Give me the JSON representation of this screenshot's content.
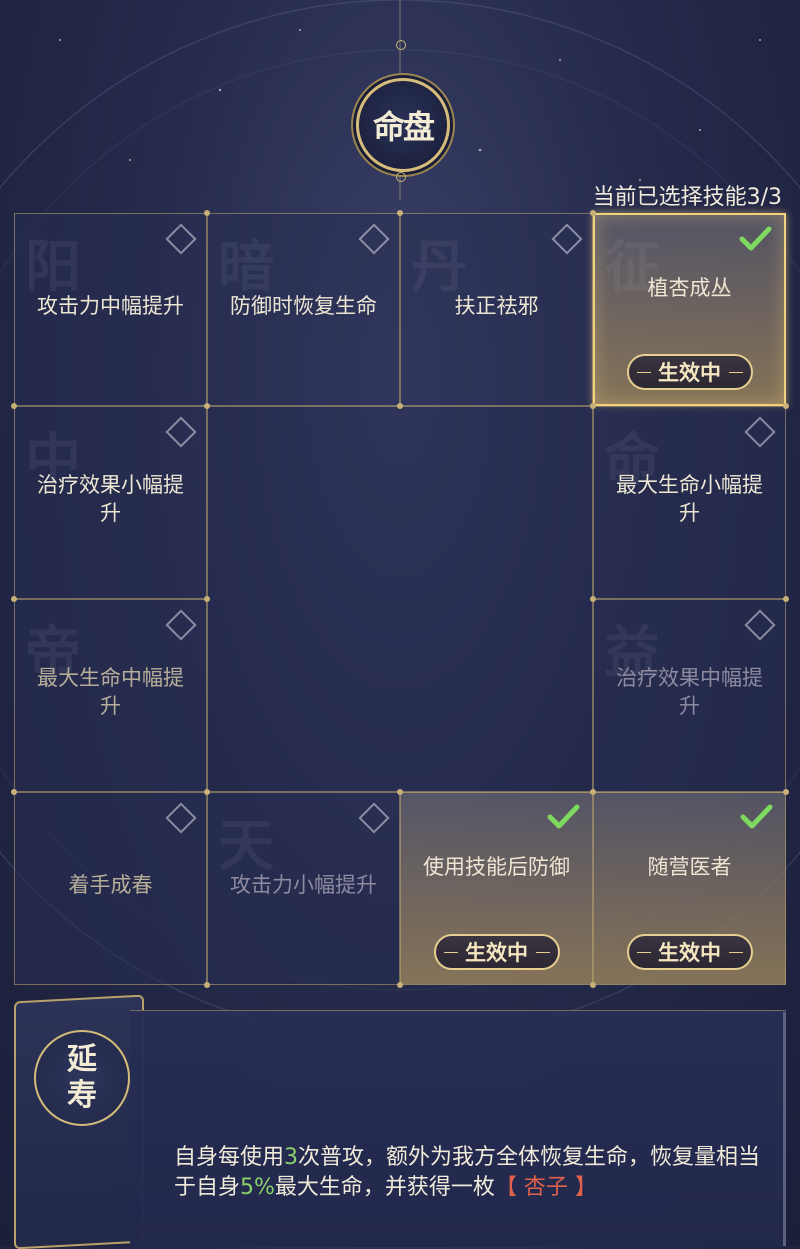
{
  "header": {
    "title": "命盘"
  },
  "selection_status": "当前已选择技能3/3",
  "cells": [
    {
      "label": "攻击力中幅提升",
      "bg_char": "阳",
      "state": "normal",
      "selected": false,
      "badge": ""
    },
    {
      "label": "防御时恢复生命",
      "bg_char": "暗",
      "state": "normal",
      "selected": false,
      "badge": ""
    },
    {
      "label": "扶正祛邪",
      "bg_char": "丹",
      "state": "normal",
      "selected": false,
      "badge": ""
    },
    {
      "label": "植杏成丛",
      "bg_char": "征",
      "state": "active",
      "selected": true,
      "badge": "生效中"
    },
    {
      "label": "治疗效果小幅提升",
      "bg_char": "中",
      "state": "normal",
      "selected": false,
      "badge": ""
    },
    {
      "label": "最大生命小幅提升",
      "bg_char": "命",
      "state": "normal",
      "selected": false,
      "badge": ""
    },
    {
      "label": "最大生命中幅提升",
      "bg_char": "帝",
      "state": "dim",
      "selected": false,
      "badge": ""
    },
    {
      "label": "治疗效果中幅提升",
      "bg_char": "益",
      "state": "disabled",
      "selected": false,
      "badge": ""
    },
    {
      "label": "着手成春",
      "bg_char": "",
      "state": "dim",
      "selected": false,
      "badge": ""
    },
    {
      "label": "攻击力小幅提升",
      "bg_char": "天",
      "state": "disabled",
      "selected": false,
      "badge": ""
    },
    {
      "label": "使用技能后防御",
      "bg_char": "",
      "state": "active",
      "selected": true,
      "badge": "生效中"
    },
    {
      "label": "随营医者",
      "bg_char": "",
      "state": "active",
      "selected": true,
      "badge": "生效中"
    }
  ],
  "detail": {
    "emblem_line1": "延",
    "emblem_line2": "寿",
    "text_parts": [
      {
        "text": "自身每使用",
        "style": "normal"
      },
      {
        "text": "3",
        "style": "green"
      },
      {
        "text": "次普攻，额外为我方全体恢复生命，恢复量相当于自身",
        "style": "normal"
      },
      {
        "text": "5%",
        "style": "green"
      },
      {
        "text": "最大生命，并获得一枚",
        "style": "normal"
      },
      {
        "text": "【 杏子 】",
        "style": "red"
      }
    ]
  },
  "colors": {
    "gold": "#d6bd7c",
    "green_check": "#7ed95f",
    "highlight_green": "#8ad06a",
    "highlight_red": "#e0624a"
  }
}
